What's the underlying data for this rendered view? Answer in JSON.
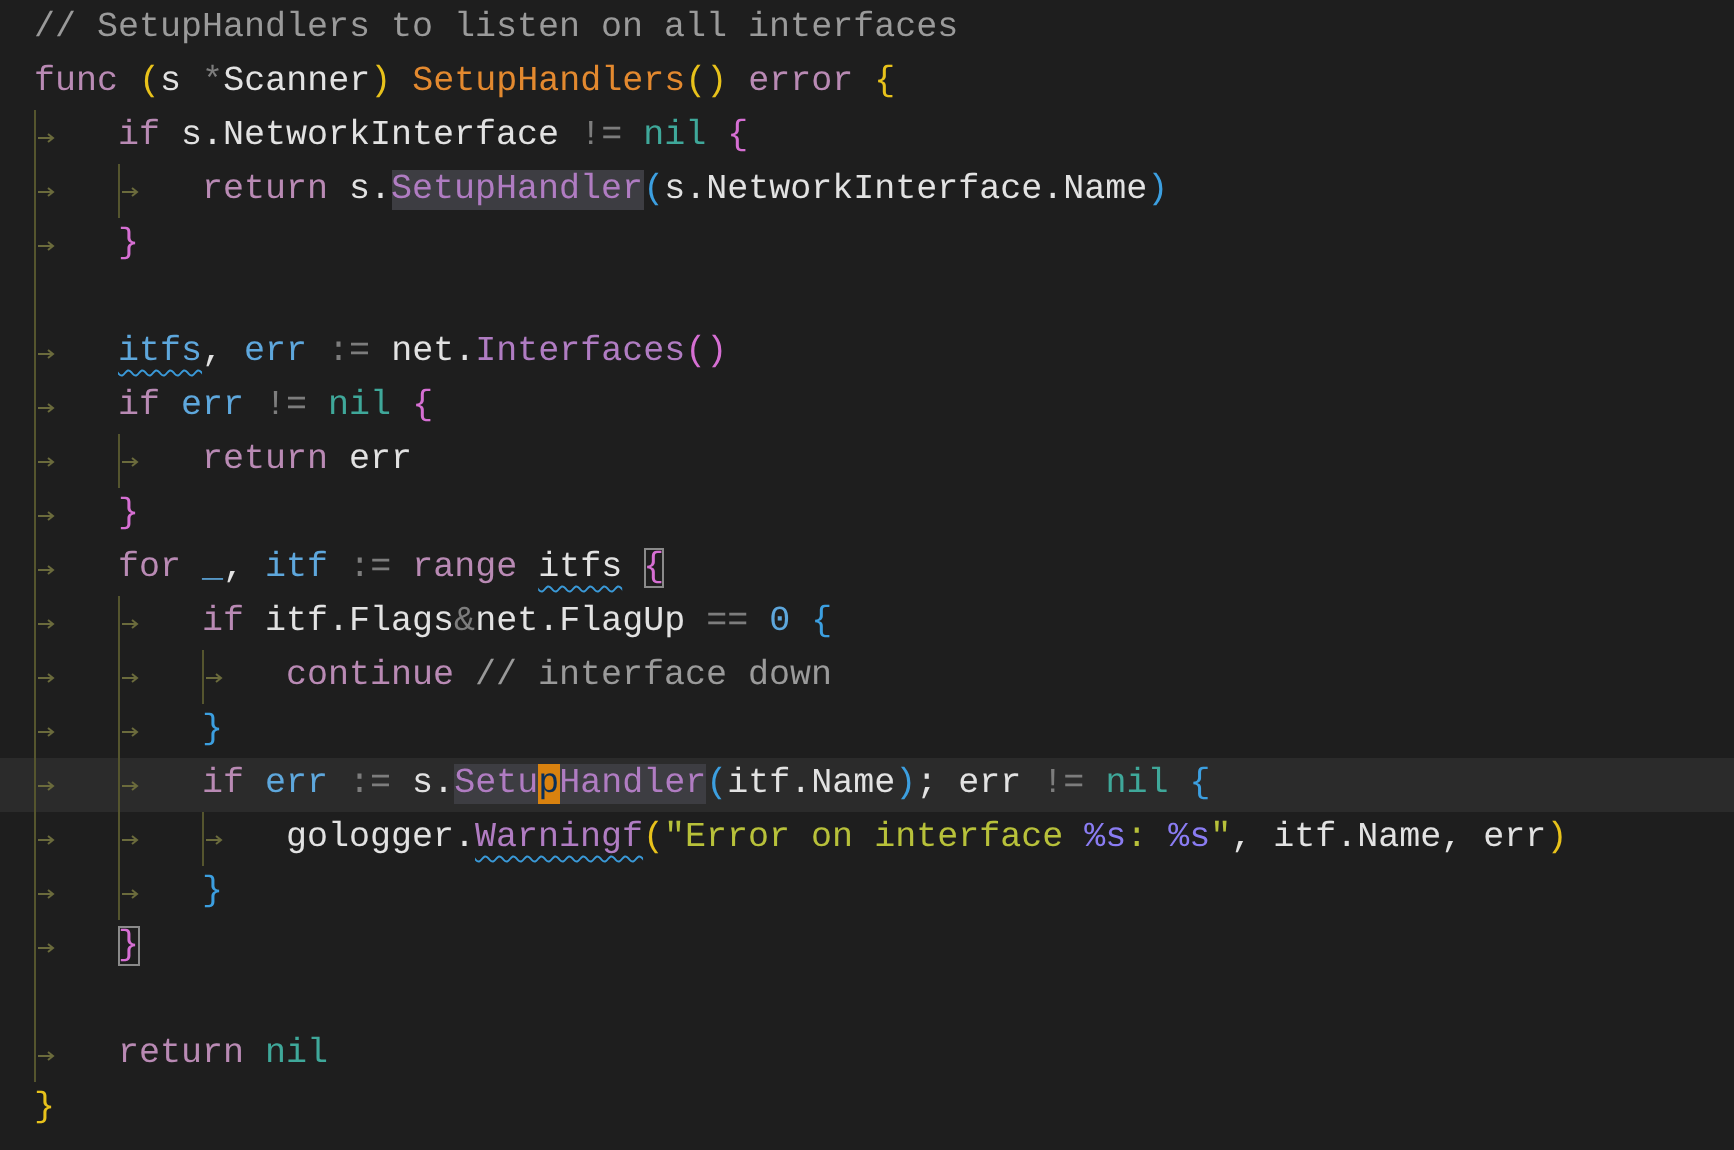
{
  "editor": {
    "lines": [
      {
        "active": false,
        "tokens": [
          {
            "text": "// SetupHandlers to listen on all interfaces",
            "kind": "comment"
          }
        ]
      },
      {
        "active": false,
        "tokens": [
          {
            "text": "func ",
            "kind": "keyword"
          },
          {
            "text": "(",
            "kind": "paren1"
          },
          {
            "text": "s ",
            "kind": "plain"
          },
          {
            "text": "*",
            "kind": "op"
          },
          {
            "text": "Scanner",
            "kind": "plain"
          },
          {
            "text": ") ",
            "kind": "paren1"
          },
          {
            "text": "SetupHandlers",
            "kind": "decl"
          },
          {
            "text": "() ",
            "kind": "paren1"
          },
          {
            "text": "error ",
            "kind": "keyword"
          },
          {
            "text": "{",
            "kind": "paren1"
          }
        ]
      },
      {
        "active": false,
        "tokens": [
          {
            "kind": "tab"
          },
          {
            "text": "if",
            "kind": "keyword"
          },
          {
            "text": " s.NetworkInterface ",
            "kind": "plain"
          },
          {
            "text": "!= ",
            "kind": "op"
          },
          {
            "text": "nil ",
            "kind": "nil"
          },
          {
            "text": "{",
            "kind": "paren2"
          }
        ]
      },
      {
        "active": false,
        "tokens": [
          {
            "kind": "tab"
          },
          {
            "kind": "tab"
          },
          {
            "text": "return",
            "kind": "keyword"
          },
          {
            "text": " s.",
            "kind": "plain"
          },
          {
            "text": "SetupHandler",
            "kind": "method",
            "highlighted": true
          },
          {
            "text": "(",
            "kind": "paren3"
          },
          {
            "text": "s.NetworkInterface.Name",
            "kind": "plain"
          },
          {
            "text": ")",
            "kind": "paren3"
          }
        ]
      },
      {
        "active": false,
        "tokens": [
          {
            "kind": "tab"
          },
          {
            "text": "}",
            "kind": "paren2"
          }
        ]
      },
      {
        "active": false,
        "tokens": [
          {
            "kind": "guide"
          }
        ]
      },
      {
        "active": false,
        "tokens": [
          {
            "kind": "tab"
          },
          {
            "text": "itfs",
            "kind": "var",
            "squiggle": true
          },
          {
            "text": ", ",
            "kind": "plain"
          },
          {
            "text": "err ",
            "kind": "var"
          },
          {
            "text": ":=",
            "kind": "op"
          },
          {
            "text": " net.",
            "kind": "plain"
          },
          {
            "text": "Interfaces",
            "kind": "method"
          },
          {
            "text": "()",
            "kind": "paren2"
          }
        ]
      },
      {
        "active": false,
        "tokens": [
          {
            "kind": "tab"
          },
          {
            "text": "if ",
            "kind": "keyword"
          },
          {
            "text": "err ",
            "kind": "var"
          },
          {
            "text": "!= ",
            "kind": "op"
          },
          {
            "text": "nil ",
            "kind": "nil"
          },
          {
            "text": "{",
            "kind": "paren2"
          }
        ]
      },
      {
        "active": false,
        "tokens": [
          {
            "kind": "tab"
          },
          {
            "kind": "tab"
          },
          {
            "text": "return",
            "kind": "keyword"
          },
          {
            "text": " err",
            "kind": "plain"
          }
        ]
      },
      {
        "active": false,
        "tokens": [
          {
            "kind": "tab"
          },
          {
            "text": "}",
            "kind": "paren2"
          }
        ]
      },
      {
        "active": false,
        "tokens": [
          {
            "kind": "tab"
          },
          {
            "text": "for ",
            "kind": "keyword"
          },
          {
            "text": "_",
            "kind": "var"
          },
          {
            "text": ", ",
            "kind": "plain"
          },
          {
            "text": "itf ",
            "kind": "var"
          },
          {
            "text": ":= ",
            "kind": "op"
          },
          {
            "text": "range ",
            "kind": "keyword"
          },
          {
            "text": "itfs",
            "kind": "plain",
            "squiggle": true
          },
          {
            "text": " {",
            "kind": "paren2",
            "bracket_match": true
          }
        ]
      },
      {
        "active": false,
        "tokens": [
          {
            "kind": "tab"
          },
          {
            "kind": "tab"
          },
          {
            "text": "if",
            "kind": "keyword"
          },
          {
            "text": " itf.Flags",
            "kind": "plain"
          },
          {
            "text": "&",
            "kind": "op"
          },
          {
            "text": "net.FlagUp ",
            "kind": "plain"
          },
          {
            "text": "== ",
            "kind": "op"
          },
          {
            "text": "0 ",
            "kind": "number"
          },
          {
            "text": "{",
            "kind": "paren3"
          }
        ]
      },
      {
        "active": false,
        "tokens": [
          {
            "kind": "tab"
          },
          {
            "kind": "tab"
          },
          {
            "kind": "tab"
          },
          {
            "text": "continue ",
            "kind": "keyword"
          },
          {
            "text": "// interface down",
            "kind": "comment"
          }
        ]
      },
      {
        "active": false,
        "tokens": [
          {
            "kind": "tab"
          },
          {
            "kind": "tab"
          },
          {
            "text": "}",
            "kind": "paren3"
          }
        ]
      },
      {
        "active": true,
        "tokens": [
          {
            "kind": "tab"
          },
          {
            "kind": "tab"
          },
          {
            "text": "if ",
            "kind": "keyword"
          },
          {
            "text": "err ",
            "kind": "var"
          },
          {
            "text": ":=",
            "kind": "op"
          },
          {
            "text": " s.",
            "kind": "plain"
          },
          {
            "text": "Setu",
            "kind": "method",
            "highlighted": true
          },
          {
            "text": "p",
            "kind": "method",
            "highlighted": true,
            "cursor": true
          },
          {
            "text": "Handler",
            "kind": "method",
            "highlighted": true
          },
          {
            "text": "(",
            "kind": "paren3"
          },
          {
            "text": "itf.Name",
            "kind": "plain"
          },
          {
            "text": ")",
            "kind": "paren3"
          },
          {
            "text": "; err ",
            "kind": "plain"
          },
          {
            "text": "!= ",
            "kind": "op"
          },
          {
            "text": "nil ",
            "kind": "nil"
          },
          {
            "text": "{",
            "kind": "paren3"
          }
        ]
      },
      {
        "active": false,
        "tokens": [
          {
            "kind": "tab"
          },
          {
            "kind": "tab"
          },
          {
            "kind": "tab"
          },
          {
            "text": "gologger.",
            "kind": "plain"
          },
          {
            "text": "Warningf",
            "kind": "method",
            "squiggle": true
          },
          {
            "text": "(",
            "kind": "paren1"
          },
          {
            "text": "\"Error on interface ",
            "kind": "string"
          },
          {
            "text": "%s",
            "kind": "format"
          },
          {
            "text": ": ",
            "kind": "string"
          },
          {
            "text": "%s",
            "kind": "format"
          },
          {
            "text": "\"",
            "kind": "string"
          },
          {
            "text": ", itf.Name, err",
            "kind": "plain"
          },
          {
            "text": ")",
            "kind": "paren1"
          }
        ]
      },
      {
        "active": false,
        "tokens": [
          {
            "kind": "tab"
          },
          {
            "kind": "tab"
          },
          {
            "text": "}",
            "kind": "paren3"
          }
        ]
      },
      {
        "active": false,
        "tokens": [
          {
            "kind": "tab"
          },
          {
            "text": "}",
            "kind": "paren2",
            "bracket_match": true
          }
        ]
      },
      {
        "active": false,
        "tokens": [
          {
            "kind": "guide"
          }
        ]
      },
      {
        "active": false,
        "tokens": [
          {
            "kind": "tab"
          },
          {
            "text": "return ",
            "kind": "keyword"
          },
          {
            "text": "nil",
            "kind": "nil"
          }
        ]
      },
      {
        "active": false,
        "tokens": [
          {
            "text": "}",
            "kind": "paren1"
          }
        ]
      }
    ]
  }
}
